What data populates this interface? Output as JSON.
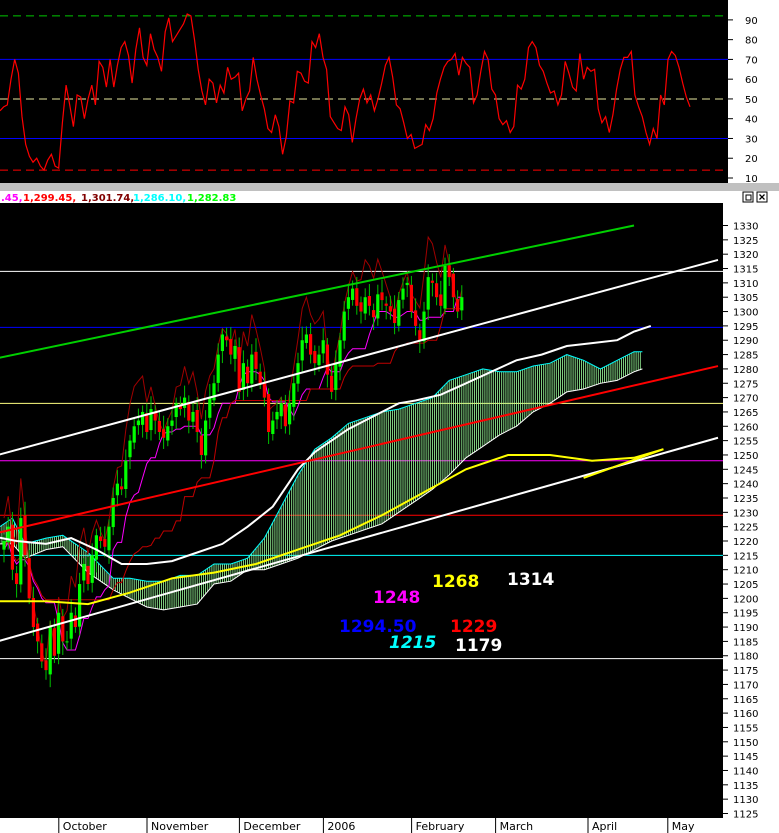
{
  "chart_data": [
    {
      "type": "line",
      "panel": "oscillator",
      "ylim": [
        10,
        95
      ],
      "yticks": [
        "90",
        "80",
        "70",
        "60",
        "50",
        "40",
        "30",
        "20",
        "10"
      ],
      "reference_lines": [
        {
          "value": 92,
          "color": "#00c800",
          "style": "dashed"
        },
        {
          "value": 70,
          "color": "#0000ff",
          "style": "solid"
        },
        {
          "value": 50,
          "color": "#e8e8a0",
          "style": "dashed"
        },
        {
          "value": 30,
          "color": "#0000ff",
          "style": "solid"
        },
        {
          "value": 14,
          "color": "#ff0000",
          "style": "dashed"
        }
      ],
      "series": [
        {
          "color": "#ff0000",
          "values": [
            44,
            46,
            47,
            60,
            70,
            63,
            41,
            27,
            21,
            18,
            20,
            16,
            14,
            19,
            22,
            16,
            15,
            38,
            57,
            47,
            36,
            52,
            51,
            40,
            50,
            57,
            47,
            69,
            66,
            56,
            70,
            56,
            67,
            76,
            79,
            72,
            58,
            75,
            86,
            71,
            67,
            83,
            75,
            71,
            64,
            84,
            91,
            79,
            82,
            85,
            88,
            93,
            92,
            80,
            65,
            54,
            47,
            60,
            58,
            48,
            57,
            53,
            66,
            60,
            61,
            63,
            44,
            50,
            54,
            71,
            60,
            52,
            45,
            35,
            33,
            42,
            36,
            22,
            31,
            49,
            48,
            64,
            63,
            59,
            58,
            79,
            76,
            83,
            71,
            65,
            41,
            38,
            35,
            34,
            46,
            42,
            28,
            40,
            50,
            55,
            48,
            52,
            44,
            50,
            58,
            67,
            71,
            61,
            47,
            45,
            38,
            30,
            32,
            25,
            26,
            27,
            37,
            34,
            40,
            53,
            60,
            66,
            69,
            70,
            73,
            62,
            71,
            68,
            66,
            48,
            52,
            64,
            74,
            70,
            55,
            52,
            40,
            37,
            39,
            33,
            36,
            57,
            55,
            60,
            76,
            79,
            76,
            67,
            64,
            58,
            53,
            54,
            47,
            52,
            69,
            63,
            56,
            54,
            73,
            60,
            66,
            64,
            65,
            45,
            38,
            41,
            33,
            42,
            55,
            65,
            71,
            71,
            74,
            52,
            46,
            41,
            33,
            27,
            35,
            30,
            52,
            47,
            70,
            74,
            72,
            66,
            58,
            51,
            46
          ]
        }
      ],
      "window_buttons": []
    },
    {
      "type": "line",
      "panel": "price",
      "ylim": [
        1120,
        1335
      ],
      "yticks": [
        "1330",
        "1325",
        "1320",
        "1315",
        "1310",
        "1305",
        "1300",
        "1295",
        "1290",
        "1285",
        "1280",
        "1275",
        "1270",
        "1265",
        "1260",
        "1255",
        "1250",
        "1245",
        "1240",
        "1235",
        "1230",
        "1225",
        "1220",
        "1215",
        "1210",
        "1205",
        "1200",
        "1195",
        "1190",
        "1185",
        "1180",
        "1175",
        "1170",
        "1165",
        "1160",
        "1155",
        "1150",
        "1145",
        "1140",
        "1135",
        "1130",
        "1125"
      ],
      "months": [
        {
          "label": "October",
          "slot": 14
        },
        {
          "label": "November",
          "slot": 35
        },
        {
          "label": "December",
          "slot": 57
        },
        {
          "label": "2006",
          "slot": 77
        },
        {
          "label": "February",
          "slot": 98
        },
        {
          "label": "March",
          "slot": 118
        },
        {
          "label": "April",
          "slot": 140
        },
        {
          "label": "May",
          "slot": 159
        }
      ],
      "header_values": [
        {
          "text": ".45,",
          "color": "#ff00ff"
        },
        {
          "text": "1,299.45,",
          "color": "#ff0000"
        },
        {
          "text": "1,301.74,",
          "color": "#800000"
        },
        {
          "text": "1,286.10,",
          "color": "#00ffff"
        },
        {
          "text": "1,282.83",
          "color": "#00ff00"
        },
        {
          "text": ")",
          "color": "#ffffff"
        }
      ],
      "horizontal_levels": [
        {
          "value": 1314,
          "color": "#ffffff"
        },
        {
          "value": 1294.5,
          "color": "#0000ff"
        },
        {
          "value": 1268,
          "color": "#ffff80"
        },
        {
          "value": 1248,
          "color": "#ff00ff"
        },
        {
          "value": 1229,
          "color": "#ff0000"
        },
        {
          "value": 1215,
          "color": "#00ffff"
        },
        {
          "value": 1179,
          "color": "#ffffff"
        }
      ],
      "level_labels": [
        {
          "text": "1268",
          "color": "#ffff00"
        },
        {
          "text": "1314",
          "color": "#ffffff"
        },
        {
          "text": "1248",
          "color": "#ff00ff"
        },
        {
          "text": "1294.50",
          "color": "#0000ff"
        },
        {
          "text": "1229",
          "color": "#ff0000"
        },
        {
          "text": "1215",
          "color": "#00ffff",
          "italic": true
        },
        {
          "text": "1179",
          "color": "#ffffff"
        }
      ],
      "trendlines": [
        {
          "color": "#00d000",
          "from": [
            -4,
            1283
          ],
          "to": [
            150,
            1330
          ]
        },
        {
          "color": "#ffffff",
          "from": [
            -4,
            1249
          ],
          "to": [
            170,
            1318
          ]
        },
        {
          "color": "#ffffff",
          "from": [
            -4,
            1184
          ],
          "to": [
            170,
            1256
          ]
        },
        {
          "color": "#ff0000",
          "from": [
            -4,
            1222
          ],
          "to": [
            170,
            1281
          ]
        },
        {
          "color": "#ffff00",
          "from": [
            138,
            1242
          ],
          "to": [
            157,
            1252
          ]
        }
      ],
      "moving_averages": [
        {
          "color": "#ffff00",
          "points": [
            [
              -4,
              1199
            ],
            [
              10,
              1199
            ],
            [
              20,
              1198
            ],
            [
              30,
              1202
            ],
            [
              40,
              1207
            ],
            [
              50,
              1209
            ],
            [
              60,
              1212
            ],
            [
              70,
              1217
            ],
            [
              80,
              1222
            ],
            [
              90,
              1229
            ],
            [
              100,
              1237
            ],
            [
              110,
              1245
            ],
            [
              120,
              1250
            ],
            [
              130,
              1250
            ],
            [
              140,
              1248
            ],
            [
              150,
              1249
            ],
            [
              157,
              1252
            ]
          ]
        },
        {
          "color": "#ffffff",
          "points": [
            [
              -4,
              1222
            ],
            [
              3,
              1220
            ],
            [
              10,
              1219
            ],
            [
              16,
              1221
            ],
            [
              22,
              1217
            ],
            [
              28,
              1212
            ],
            [
              34,
              1212
            ],
            [
              40,
              1213
            ],
            [
              46,
              1216
            ],
            [
              52,
              1219
            ],
            [
              58,
              1225
            ],
            [
              64,
              1232
            ],
            [
              70,
              1245
            ],
            [
              74,
              1251
            ],
            [
              78,
              1255
            ],
            [
              82,
              1259
            ],
            [
              86,
              1262
            ],
            [
              90,
              1265
            ],
            [
              94,
              1268
            ],
            [
              98,
              1269
            ],
            [
              104,
              1271
            ],
            [
              110,
              1275
            ],
            [
              116,
              1279
            ],
            [
              122,
              1283
            ],
            [
              128,
              1285
            ],
            [
              134,
              1288
            ],
            [
              140,
              1289
            ],
            [
              146,
              1290
            ],
            [
              150,
              1293
            ],
            [
              154,
              1295
            ]
          ]
        }
      ],
      "cloud": [
        {
          "slot": -1,
          "a": 1225,
          "b": 1219
        },
        {
          "slot": 2,
          "a": 1228,
          "b": 1219
        },
        {
          "slot": 5,
          "a": 1219,
          "b": 1214
        },
        {
          "slot": 10,
          "a": 1221,
          "b": 1217
        },
        {
          "slot": 14,
          "a": 1222,
          "b": 1218
        },
        {
          "slot": 20,
          "a": 1216,
          "b": 1209
        },
        {
          "slot": 26,
          "a": 1207,
          "b": 1203
        },
        {
          "slot": 30,
          "a": 1207,
          "b": 1200
        },
        {
          "slot": 34,
          "a": 1206,
          "b": 1197
        },
        {
          "slot": 38,
          "a": 1206,
          "b": 1196
        },
        {
          "slot": 42,
          "a": 1208,
          "b": 1197
        },
        {
          "slot": 46,
          "a": 1208,
          "b": 1198
        },
        {
          "slot": 50,
          "a": 1212,
          "b": 1205
        },
        {
          "slot": 54,
          "a": 1212,
          "b": 1206
        },
        {
          "slot": 58,
          "a": 1214,
          "b": 1210
        },
        {
          "slot": 62,
          "a": 1221,
          "b": 1210
        },
        {
          "slot": 66,
          "a": 1232,
          "b": 1212
        },
        {
          "slot": 70,
          "a": 1243,
          "b": 1214
        },
        {
          "slot": 74,
          "a": 1252,
          "b": 1217
        },
        {
          "slot": 78,
          "a": 1256,
          "b": 1220
        },
        {
          "slot": 82,
          "a": 1261,
          "b": 1222
        },
        {
          "slot": 86,
          "a": 1263,
          "b": 1224
        },
        {
          "slot": 90,
          "a": 1265,
          "b": 1226
        },
        {
          "slot": 94,
          "a": 1266,
          "b": 1230
        },
        {
          "slot": 98,
          "a": 1268,
          "b": 1234
        },
        {
          "slot": 102,
          "a": 1270,
          "b": 1238
        },
        {
          "slot": 106,
          "a": 1276,
          "b": 1243
        },
        {
          "slot": 110,
          "a": 1278,
          "b": 1249
        },
        {
          "slot": 114,
          "a": 1280,
          "b": 1253
        },
        {
          "slot": 118,
          "a": 1279,
          "b": 1257
        },
        {
          "slot": 122,
          "a": 1279,
          "b": 1260
        },
        {
          "slot": 126,
          "a": 1281,
          "b": 1265
        },
        {
          "slot": 130,
          "a": 1282,
          "b": 1268
        },
        {
          "slot": 134,
          "a": 1285,
          "b": 1272
        },
        {
          "slot": 138,
          "a": 1283,
          "b": 1273
        },
        {
          "slot": 142,
          "a": 1280,
          "b": 1275
        },
        {
          "slot": 146,
          "a": 1283,
          "b": 1276
        },
        {
          "slot": 150,
          "a": 1286,
          "b": 1279
        },
        {
          "slot": 152,
          "a": 1286,
          "b": 1280
        }
      ],
      "closes": [
        1220,
        1225,
        1210,
        1205,
        1228,
        1215,
        1200,
        1190,
        1185,
        1178,
        1175,
        1190,
        1180,
        1195,
        1185,
        1185,
        1195,
        1190,
        1205,
        1212,
        1205,
        1215,
        1222,
        1220,
        1218,
        1225,
        1235,
        1240,
        1238,
        1248,
        1255,
        1260,
        1262,
        1265,
        1258,
        1266,
        1262,
        1258,
        1256,
        1260,
        1262,
        1268,
        1266,
        1270,
        1262,
        1265,
        1258,
        1250,
        1262,
        1270,
        1275,
        1285,
        1292,
        1290,
        1285,
        1288,
        1272,
        1282,
        1275,
        1285,
        1280,
        1275,
        1270,
        1258,
        1262,
        1265,
        1268,
        1260,
        1268,
        1275,
        1282,
        1290,
        1292,
        1285,
        1282,
        1285,
        1290,
        1278,
        1272,
        1282,
        1290,
        1300,
        1305,
        1308,
        1302,
        1300,
        1305,
        1302,
        1298,
        1306,
        1304,
        1302,
        1300,
        1296,
        1304,
        1308,
        1310,
        1300,
        1295,
        1290,
        1300,
        1312,
        1310,
        1305,
        1302,
        1316,
        1312,
        1305,
        1300,
        1305
      ]
    }
  ]
}
